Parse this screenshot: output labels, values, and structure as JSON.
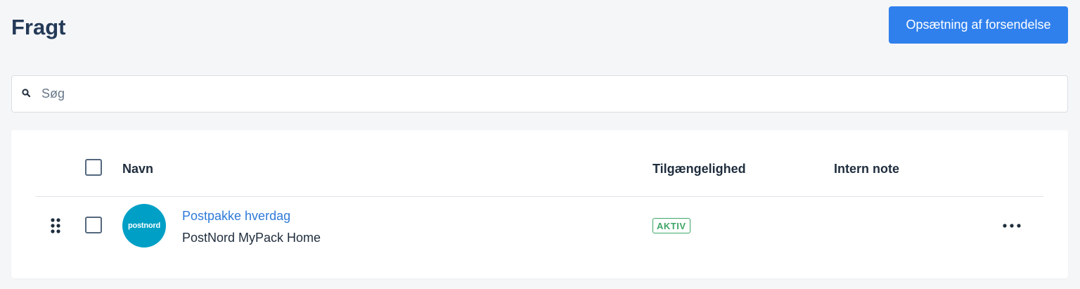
{
  "header": {
    "title": "Fragt",
    "setup_button_label": "Opsætning af forsendelse"
  },
  "search": {
    "placeholder": "Søg",
    "value": "",
    "icon": "search-icon"
  },
  "table": {
    "columns": {
      "name": "Navn",
      "availability": "Tilgængelighed",
      "internal_note": "Intern note"
    },
    "rows": [
      {
        "name": "Postpakke hverdag",
        "carrier": "PostNord MyPack Home",
        "logo_text": "postnord",
        "logo_color": "#00a0c6",
        "status": "AKTIV",
        "status_color": "#3ea567",
        "internal_note": ""
      }
    ]
  },
  "colors": {
    "primary": "#2f80ed",
    "link": "#2f7ad8",
    "title": "#233a57"
  }
}
